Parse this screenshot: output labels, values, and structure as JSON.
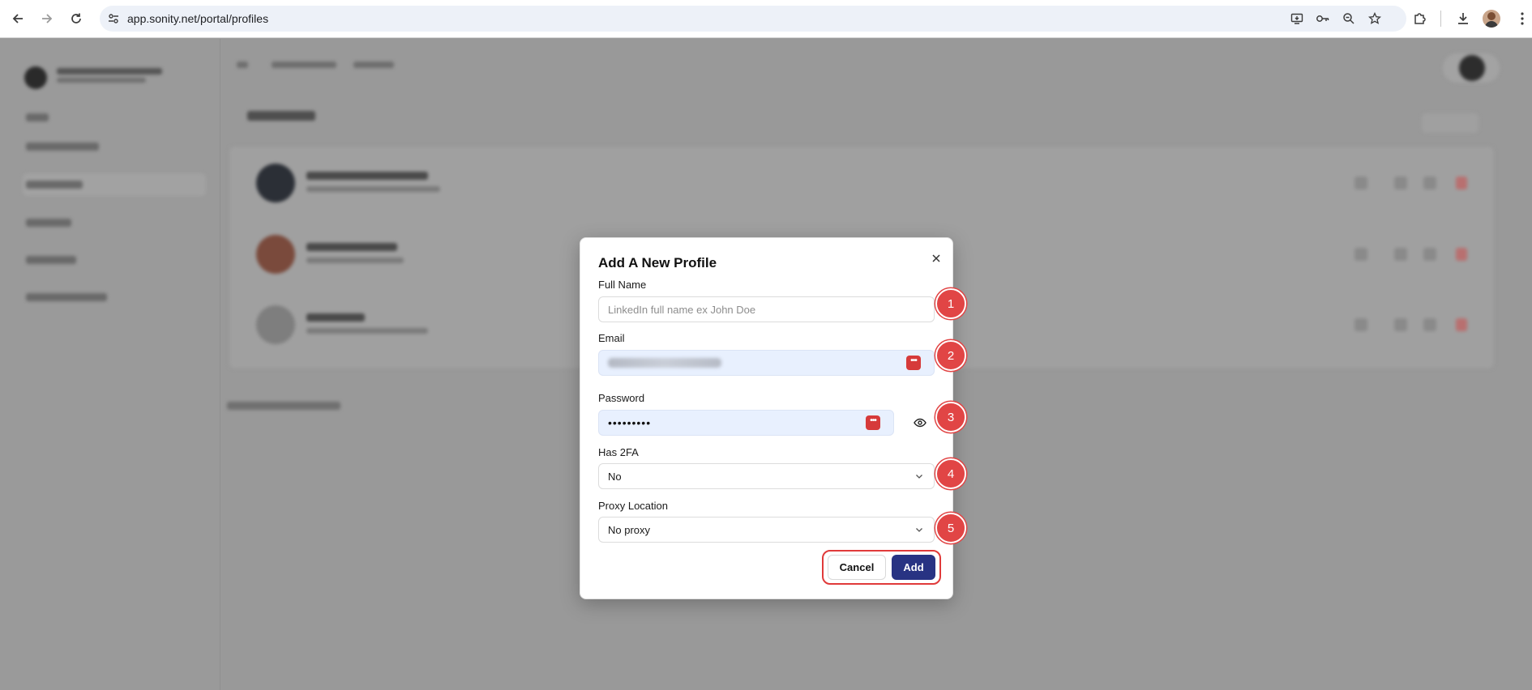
{
  "browser": {
    "url": "app.sonity.net/portal/profiles"
  },
  "modal": {
    "title": "Add A New Profile",
    "fields": {
      "full_name": {
        "label": "Full Name",
        "placeholder": "LinkedIn full name  ex John Doe",
        "value": ""
      },
      "email": {
        "label": "Email"
      },
      "password": {
        "label": "Password",
        "value": "•••••••••"
      },
      "has_2fa": {
        "label": "Has 2FA",
        "value": "No"
      },
      "proxy_location": {
        "label": "Proxy Location",
        "value": "No proxy"
      }
    },
    "cancel_label": "Cancel",
    "add_label": "Add"
  },
  "markers": [
    "1",
    "2",
    "3",
    "4",
    "5"
  ],
  "colors": {
    "primary_button": "#283383",
    "marker": "#e14545",
    "autofill_bg": "#e8f0fe"
  }
}
